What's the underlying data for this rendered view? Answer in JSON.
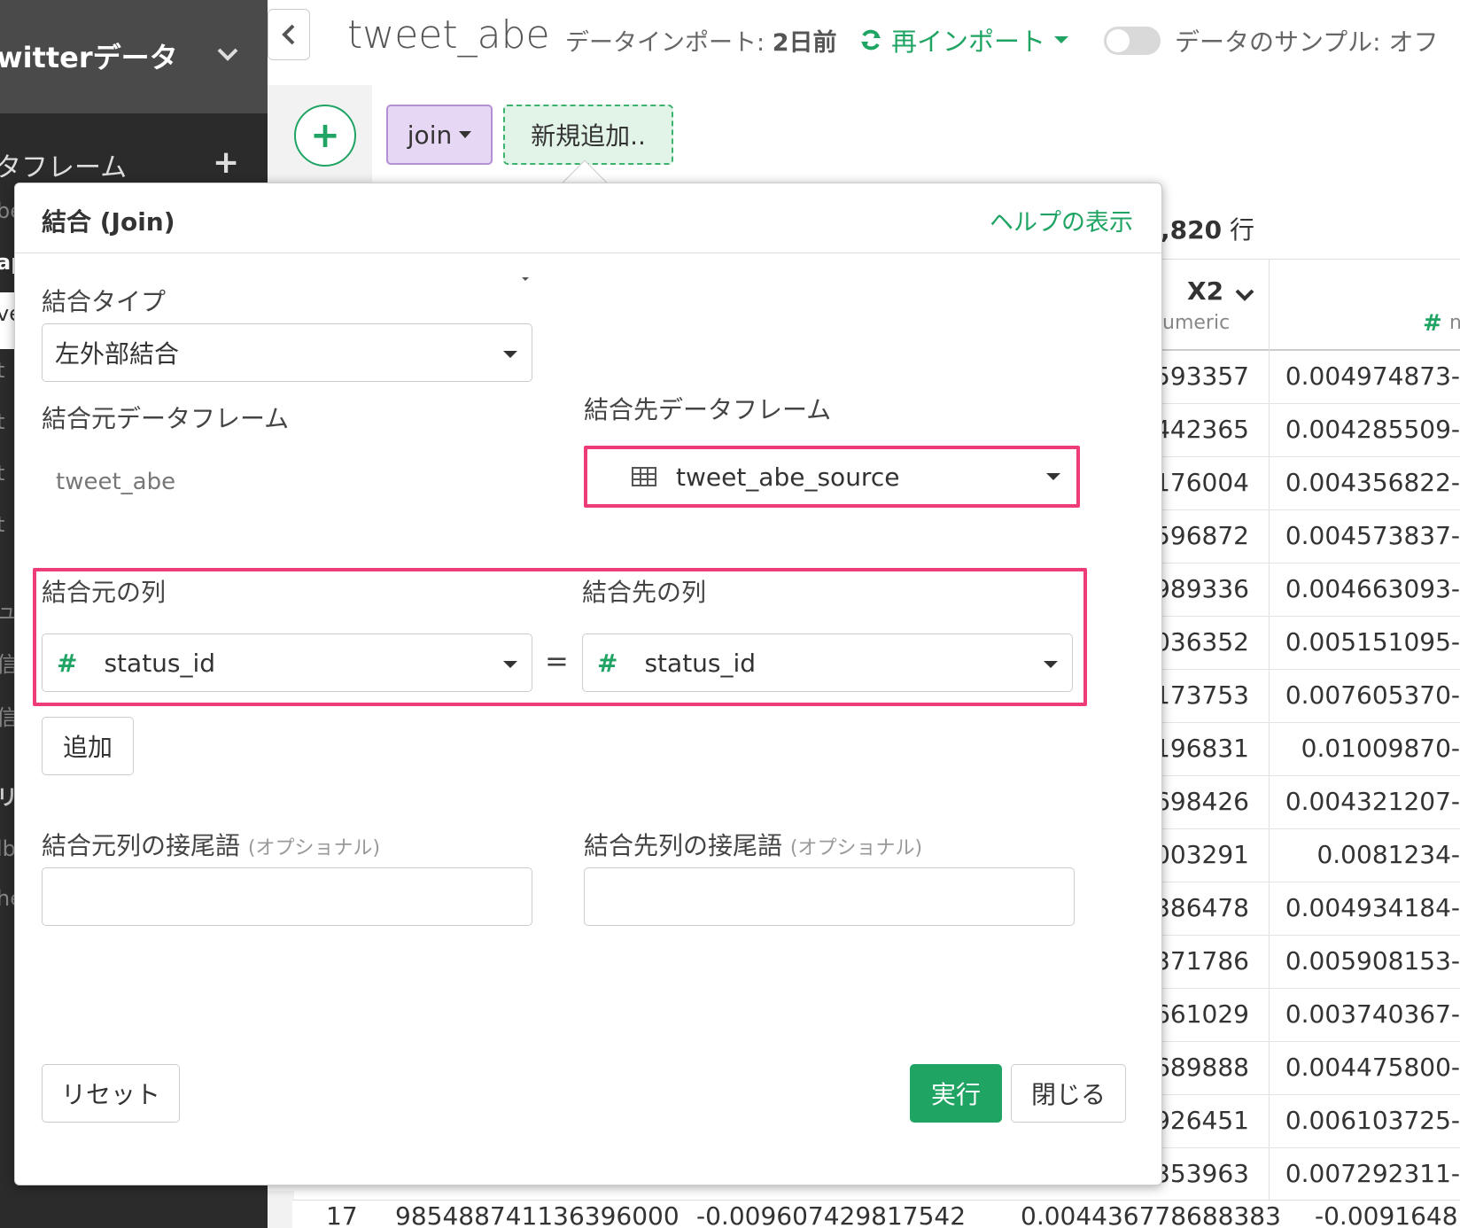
{
  "sidebar": {
    "project_name": "witterデータ",
    "section_title": "タフレーム",
    "fragments": [
      "be",
      "ap",
      "ve",
      "t",
      "t",
      "t",
      "t",
      "ュ",
      "信",
      "信",
      "リ",
      "lb",
      "he"
    ]
  },
  "header": {
    "dataframe_title": "tweet_abe",
    "import_label": "データインポート:",
    "import_age": "2日前",
    "reimport_label": "再インポート",
    "sample_label": "データのサンプル: オフ"
  },
  "steps": {
    "join_label": "join",
    "new_label": "新規追加.."
  },
  "table": {
    "row_count": ",820",
    "row_unit": "行",
    "column_name": "X2",
    "column_type": "umeric",
    "next_column_type": "n",
    "rows": [
      [
        "593357",
        "-0.004974873"
      ],
      [
        "442365",
        "-0.004285509"
      ],
      [
        "176004",
        "-0.004356822"
      ],
      [
        "596872",
        "-0.004573837"
      ],
      [
        "989336",
        "-0.004663093"
      ],
      [
        "036352",
        "-0.005151095"
      ],
      [
        "173753",
        "-0.007605370"
      ],
      [
        "196831",
        "-0.01009870"
      ],
      [
        "698426",
        "-0.004321207"
      ],
      [
        "003291",
        "-0.0081234"
      ],
      [
        "386478",
        "-0.004934184"
      ],
      [
        "371786",
        "-0.005908153"
      ],
      [
        "661029",
        "-0.003740367"
      ],
      [
        "689888",
        "-0.004475800"
      ],
      [
        "926451",
        "-0.006103725"
      ],
      [
        "353963",
        "-0.007292311"
      ]
    ],
    "bottom_row": [
      "17",
      "985488741136396000",
      "-0.009607429817542",
      "0.004436778688383",
      "-0.0091648"
    ]
  },
  "modal": {
    "title": "結合 (Join)",
    "help_link": "ヘルプの表示",
    "join_type_label": "結合タイプ",
    "join_type_value": "左外部結合",
    "source_df_label": "結合元データフレーム",
    "source_df_value": "tweet_abe",
    "target_df_label": "結合先データフレーム",
    "target_df_value": "tweet_abe_source",
    "source_col_label": "結合元の列",
    "target_col_label": "結合先の列",
    "source_col_value": "status_id",
    "target_col_value": "status_id",
    "equals": "=",
    "add_button": "追加",
    "source_suffix_label": "結合元列の接尾語",
    "target_suffix_label": "結合先列の接尾語",
    "optional_note": "(オプショナル)",
    "source_suffix_value": "",
    "target_suffix_value": "",
    "reset_button": "リセット",
    "run_button": "実行",
    "close_button": "閉じる"
  },
  "colors": {
    "accent_green": "#1fa463",
    "highlight_pink": "#ee3c78",
    "join_chip_bg": "#e6d8f5",
    "sidebar_bg": "#2b2b2b"
  }
}
